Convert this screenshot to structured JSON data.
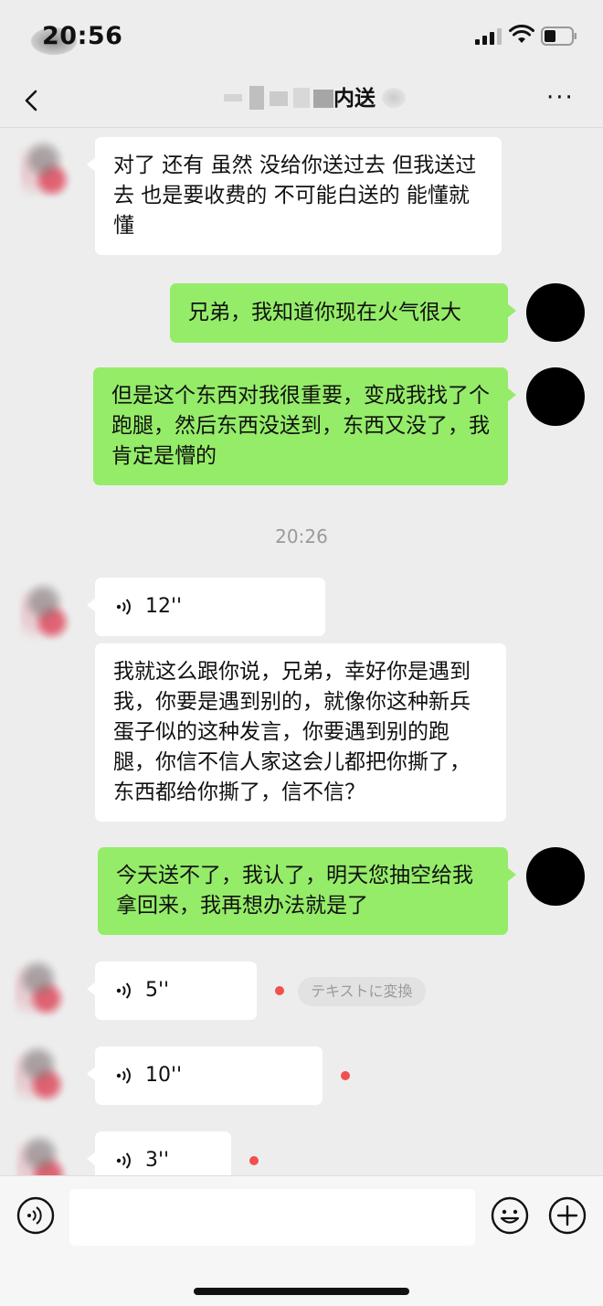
{
  "status_bar": {
    "time": "20:56"
  },
  "header": {
    "title_visible": "内送",
    "more": "···"
  },
  "messages": [
    {
      "text": "对了 还有 虽然 没给你送过去 但我送过去 也是要收费的 不可能白送的 能懂就懂"
    },
    {
      "text": "兄弟，我知道你现在火气很大"
    },
    {
      "text": "但是这个东西对我很重要，变成我找了个跑腿，然后东西没送到，东西又没了，我肯定是懵的"
    },
    {
      "text": "我就这么跟你说，兄弟，幸好你是遇到我，你要是遇到别的，就像你这种新兵蛋子似的这种发言，你要遇到别的跑腿，你信不信人家这会儿都把你撕了，东西都给你撕了，信不信？"
    },
    {
      "text": "今天送不了，我认了，明天您抽空给我拿回来，我再想办法就是了"
    }
  ],
  "timestamp": "20:26",
  "voices": [
    {
      "duration": "12''"
    },
    {
      "duration": "5''"
    },
    {
      "duration": "10''"
    },
    {
      "duration": "3''"
    }
  ],
  "convert_label": "テキストに変換",
  "input": {
    "placeholder": ""
  },
  "colors": {
    "outgoing_bubble": "#95ec69",
    "incoming_bubble": "#ffffff",
    "background": "#ededed",
    "unread_dot": "#f0504f"
  },
  "icons": [
    "back-icon",
    "more-icon",
    "voice-wave-icon",
    "voice-mode-icon",
    "emoji-icon",
    "plus-icon",
    "signal-icon",
    "wifi-icon",
    "battery-icon"
  ]
}
